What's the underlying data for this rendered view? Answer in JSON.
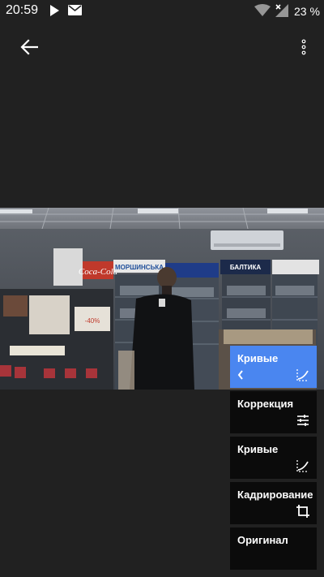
{
  "status_bar": {
    "time": "20:59",
    "battery": "23 %",
    "icons": [
      "play-icon",
      "mail-icon",
      "wifi-icon",
      "signal-icon"
    ]
  },
  "app_bar": {
    "back_icon": "arrow-left-icon",
    "menu_icon": "more-vert-icon"
  },
  "photo": {
    "signs": [
      "Coca-Cola",
      "МОРШИНСЬКА",
      "БАЛТИКА",
      "-40%"
    ]
  },
  "edit_stack": {
    "items": [
      {
        "label": "Кривые",
        "icon": "curves-icon",
        "active": true
      },
      {
        "label": "Коррекция",
        "icon": "tune-icon",
        "active": false
      },
      {
        "label": "Кривые",
        "icon": "curves-icon",
        "active": false
      },
      {
        "label": "Кадрирование",
        "icon": "crop-icon",
        "active": false
      },
      {
        "label": "Оригинал",
        "icon": "",
        "active": false
      }
    ]
  },
  "colors": {
    "background": "#212121",
    "accent": "#4a86f0",
    "stack_item": "#0b0b0b"
  }
}
